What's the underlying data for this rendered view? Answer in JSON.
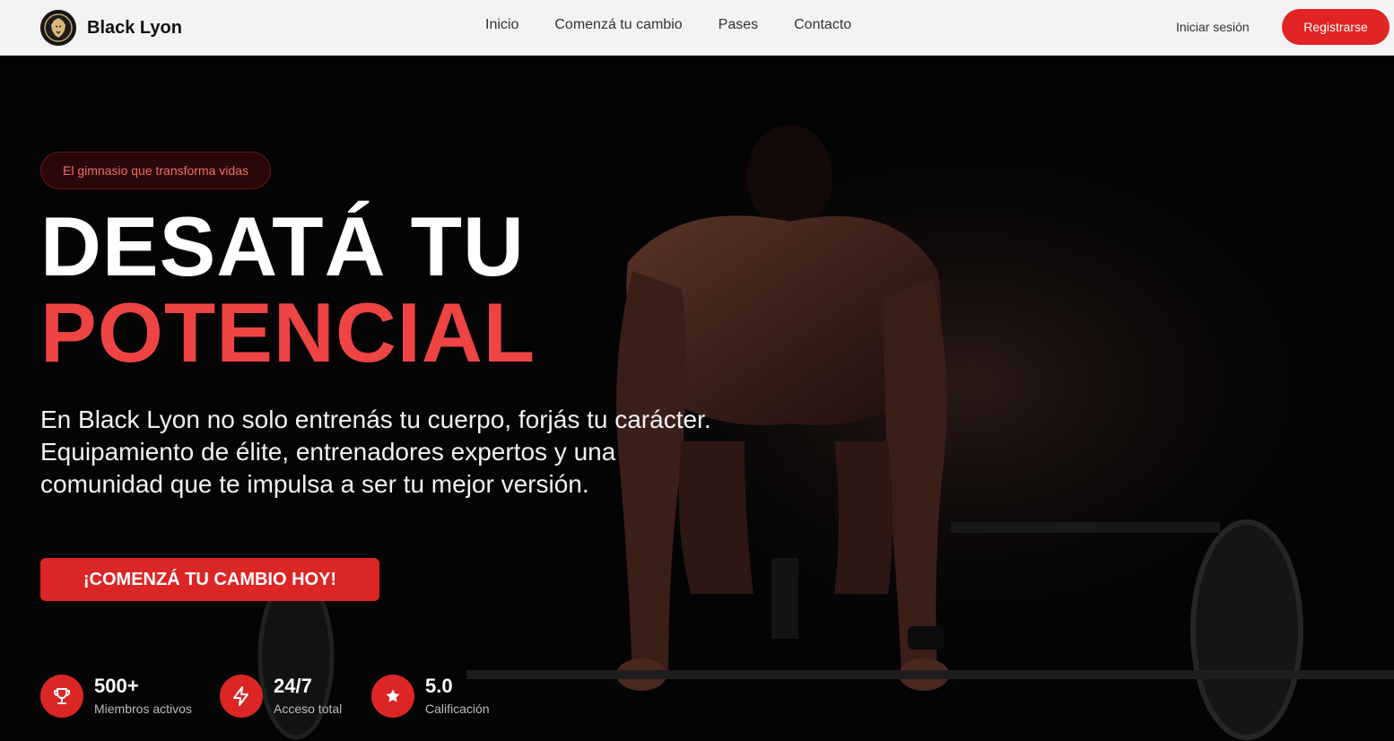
{
  "brand": {
    "name": "Black Lyon",
    "logo_icon": "lion-icon"
  },
  "nav": {
    "links": [
      "Inicio",
      "Comenzá tu cambio",
      "Pases",
      "Contacto"
    ],
    "login_label": "Iniciar sesión",
    "register_label": "Registrarse"
  },
  "hero": {
    "tagline": "El gimnasio que transforma vidas",
    "headline_line1": "DESATÁ TU",
    "headline_line2": "POTENCIAL",
    "description": "En Black Lyon no solo entrenás tu cuerpo, forjás tu carácter. Equipamiento de élite, entrenadores expertos y una comunidad que te impulsa a ser tu mejor versión.",
    "cta_label": "¡COMENZÁ TU CAMBIO HOY!",
    "background_image": "athlete-deadlift-photo"
  },
  "stats": [
    {
      "icon": "trophy-icon",
      "value": "500+",
      "label": "Miembros activos"
    },
    {
      "icon": "lightning-icon",
      "value": "24/7",
      "label": "Acceso total"
    },
    {
      "icon": "star-icon",
      "value": "5.0",
      "label": "Calificación"
    }
  ],
  "colors": {
    "accent": "#dc2626",
    "headline_accent": "#ef4444",
    "nav_background": "#f3f3f3",
    "hero_background": "#050505"
  }
}
